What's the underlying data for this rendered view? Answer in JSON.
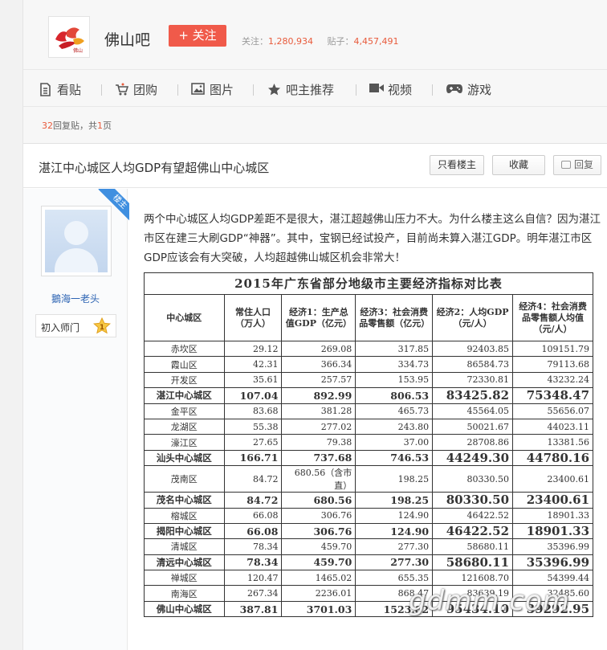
{
  "header": {
    "forum_name": "佛山吧",
    "follow_label": "+ 关注",
    "followers_label": "关注：",
    "followers": "1,280,934",
    "posts_label": "贴子：",
    "posts": "4,457,491",
    "logo_icon": "foshan-bar-logo"
  },
  "nav": [
    {
      "label": "看贴",
      "icon": "document-icon"
    },
    {
      "label": "团购",
      "icon": "cart-icon"
    },
    {
      "label": "图片",
      "icon": "image-icon"
    },
    {
      "label": "吧主推荐",
      "icon": "star-icon"
    },
    {
      "label": "视频",
      "icon": "video-icon"
    },
    {
      "label": "游戏",
      "icon": "gamepad-icon"
    }
  ],
  "reply_info": {
    "count": "32",
    "count_suffix": "回复贴，共",
    "pages": "1",
    "pages_suffix": "页"
  },
  "thread": {
    "title": "湛江中心城区人均GDP有望超佛山中心城区",
    "only_owner": "只看楼主",
    "collect": "收藏",
    "reply": "回复"
  },
  "post": {
    "floor_tag": "楼主",
    "username": "鵝海一老头",
    "badge_label": "初入师门",
    "badge_level": "1",
    "content": "两个中心城区人均GDP差距不是很大，湛江超越佛山压力不大。为什么楼主这么自信？因为湛江市区在建三大刷GDP“神器”。其中，宝钢已经试投产，目前尚未算入湛江GDP。明年湛江市区GDP应该会有大突破，人均超越佛山城区机会非常大！"
  },
  "table": {
    "title": "2015年广东省部分地级市主要经济指标对比表",
    "headers": [
      "中心城区",
      "常住人口（万人）",
      "经济1：生产总值GDP（亿元）",
      "经济3：社会消费品零售额（亿元）",
      "经济2：人均GDP（元/人）",
      "经济4：社会消费品零售额人均值（元/人）"
    ],
    "rows": [
      {
        "cells": [
          "赤坎区",
          "29.12",
          "269.08",
          "317.85",
          "92403.85",
          "109151.79"
        ],
        "major": false
      },
      {
        "cells": [
          "霞山区",
          "42.31",
          "366.34",
          "334.73",
          "86584.73",
          "79113.68"
        ],
        "major": false
      },
      {
        "cells": [
          "开发区",
          "35.61",
          "257.57",
          "153.95",
          "72330.81",
          "43232.24"
        ],
        "major": false
      },
      {
        "cells": [
          "湛江中心城区",
          "107.04",
          "892.99",
          "806.53",
          "83425.82",
          "75348.47"
        ],
        "major": true
      },
      {
        "cells": [
          "金平区",
          "83.68",
          "381.28",
          "465.73",
          "45564.05",
          "55656.07"
        ],
        "major": false
      },
      {
        "cells": [
          "龙湖区",
          "55.38",
          "277.02",
          "243.80",
          "50021.67",
          "44023.11"
        ],
        "major": false
      },
      {
        "cells": [
          "濠江区",
          "27.65",
          "79.38",
          "37.00",
          "28708.86",
          "13381.56"
        ],
        "major": false
      },
      {
        "cells": [
          "汕头中心城区",
          "166.71",
          "737.68",
          "746.53",
          "44249.30",
          "44780.16"
        ],
        "major": true
      },
      {
        "cells": [
          "茂南区",
          "84.72",
          "680.56（含市直）",
          "198.25",
          "80330.50",
          "23400.61"
        ],
        "major": false
      },
      {
        "cells": [
          "茂名中心城区",
          "84.72",
          "680.56",
          "198.25",
          "80330.50",
          "23400.61"
        ],
        "major": true
      },
      {
        "cells": [
          "榕城区",
          "66.08",
          "306.76",
          "124.90",
          "46422.52",
          "18901.33"
        ],
        "major": false
      },
      {
        "cells": [
          "揭阳中心城区",
          "66.08",
          "306.76",
          "124.90",
          "46422.52",
          "18901.33"
        ],
        "major": true
      },
      {
        "cells": [
          "清城区",
          "78.34",
          "459.70",
          "277.30",
          "58680.11",
          "35396.99"
        ],
        "major": false
      },
      {
        "cells": [
          "清远中心城区",
          "78.34",
          "459.70",
          "277.30",
          "58680.11",
          "35396.99"
        ],
        "major": true
      },
      {
        "cells": [
          "禅城区",
          "120.47",
          "1465.02",
          "655.35",
          "121608.70",
          "54399.44"
        ],
        "major": false
      },
      {
        "cells": [
          "南海区",
          "267.34",
          "2236.01",
          "868.47",
          "83639.19",
          "32485.60"
        ],
        "major": false
      },
      {
        "cells": [
          "佛山中心城区",
          "387.81",
          "3701.03",
          "1523.82",
          "95434.10",
          "39292.95"
        ],
        "major": true
      }
    ]
  },
  "watermark": "gdmm.com"
}
